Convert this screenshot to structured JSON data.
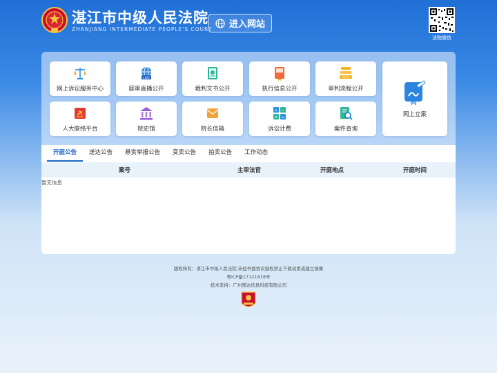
{
  "header": {
    "title_cn": "湛江市中级人民法院",
    "title_en": "ZHANJIANG INTERMEDIATE PEOPLE'S COURT",
    "enter_button": "进入网站",
    "qr_label": "法院微信"
  },
  "tiles": [
    {
      "label": "网上诉讼服务中心",
      "icon": "scales-icon"
    },
    {
      "label": "庭审直播公开",
      "icon": "live-globe-icon"
    },
    {
      "label": "裁判文书公开",
      "icon": "document-book-icon"
    },
    {
      "label": "执行信息公开",
      "icon": "execution-book-icon"
    },
    {
      "label": "审判流程公开",
      "icon": "process-stack-icon"
    },
    {
      "label": "人大联络平台",
      "icon": "party-emblem-icon"
    },
    {
      "label": "院史馆",
      "icon": "museum-building-icon"
    },
    {
      "label": "院长信箱",
      "icon": "mailbox-icon"
    },
    {
      "label": "诉讼计费",
      "icon": "calculator-icon"
    },
    {
      "label": "案件查询",
      "icon": "case-search-icon"
    }
  ],
  "big_tile": {
    "label": "网上立案",
    "icon": "online-filing-icon"
  },
  "tabs": [
    "开庭公告",
    "送达公告",
    "悬赏举报公告",
    "变卖公告",
    "拍卖公告",
    "工作动态"
  ],
  "table": {
    "headers": [
      "案号",
      "主审法官",
      "开庭地点",
      "开庭时间"
    ],
    "empty_text": "暂无信息"
  },
  "footer": {
    "copyright": "版权所有：湛江市中级人民法院 未经书面协议授权禁止下载试用或建立镜像",
    "icp": "粤ICP备17121818号",
    "support": "技术支持：广州窝达信息科技有限公司"
  },
  "colors": {
    "accent": "#1a63c7",
    "header_bg": "#1f6fd6",
    "tile_bg": "#ffffff"
  }
}
